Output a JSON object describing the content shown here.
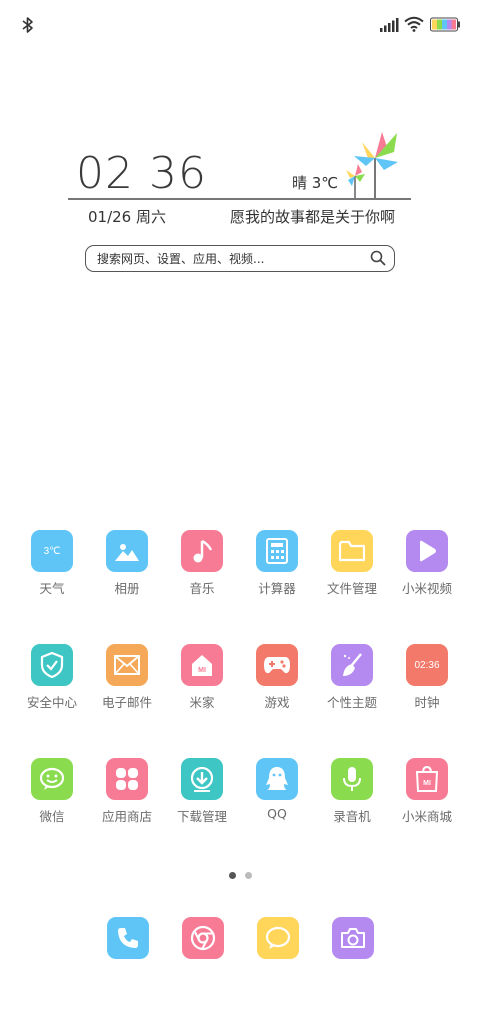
{
  "status_bar": {
    "left_icon": "bluetooth-icon",
    "right_icons": [
      "signal-icon",
      "wifi-icon",
      "battery-icon"
    ]
  },
  "clock_widget": {
    "time": "02 36",
    "weather": "晴 3℃",
    "date": "01/26 周六",
    "motto": "愿我的故事都是关于你啊",
    "decoration_icon": "pinwheel-icon"
  },
  "search": {
    "placeholder": "搜索网页、设置、应用、视频..."
  },
  "apps": [
    {
      "label": "天气",
      "icon": "weather-icon",
      "icon_text": "3℃",
      "color": "#5ec5f6"
    },
    {
      "label": "相册",
      "icon": "gallery-icon",
      "color": "#5ec5f6"
    },
    {
      "label": "音乐",
      "icon": "music-icon",
      "color": "#f87b95"
    },
    {
      "label": "计算器",
      "icon": "calculator-icon",
      "color": "#5ec5f6"
    },
    {
      "label": "文件管理",
      "icon": "folder-icon",
      "color": "#ffd55a"
    },
    {
      "label": "小米视频",
      "icon": "video-icon",
      "color": "#b58af0"
    },
    {
      "label": "安全中心",
      "icon": "shield-icon",
      "color": "#3ec6c4"
    },
    {
      "label": "电子邮件",
      "icon": "email-icon",
      "color": "#f5a857"
    },
    {
      "label": "米家",
      "icon": "mihome-icon",
      "icon_text": "MI",
      "color": "#f87b95"
    },
    {
      "label": "游戏",
      "icon": "gamepad-icon",
      "color": "#f37a6a"
    },
    {
      "label": "个性主题",
      "icon": "brush-icon",
      "color": "#b58af0"
    },
    {
      "label": "时钟",
      "icon": "clock-icon",
      "icon_text": "02:36",
      "color": "#f37a6a"
    },
    {
      "label": "微信",
      "icon": "wechat-icon",
      "color": "#8bdb4f"
    },
    {
      "label": "应用商店",
      "icon": "appstore-icon",
      "color": "#f87b95"
    },
    {
      "label": "下载管理",
      "icon": "download-icon",
      "color": "#3ec6c4"
    },
    {
      "label": "QQ",
      "icon": "qq-icon",
      "color": "#5ec5f6"
    },
    {
      "label": "录音机",
      "icon": "microphone-icon",
      "color": "#8bdb4f"
    },
    {
      "label": "小米商城",
      "icon": "mistore-icon",
      "icon_text": "MI",
      "color": "#f87b95"
    }
  ],
  "page_indicator": {
    "current": 1,
    "total": 2
  },
  "dock": [
    {
      "icon": "phone-icon",
      "color": "#5ec5f6"
    },
    {
      "icon": "browser-icon",
      "color": "#f87b95"
    },
    {
      "icon": "message-icon",
      "color": "#ffd55a"
    },
    {
      "icon": "camera-icon",
      "color": "#b58af0"
    }
  ]
}
